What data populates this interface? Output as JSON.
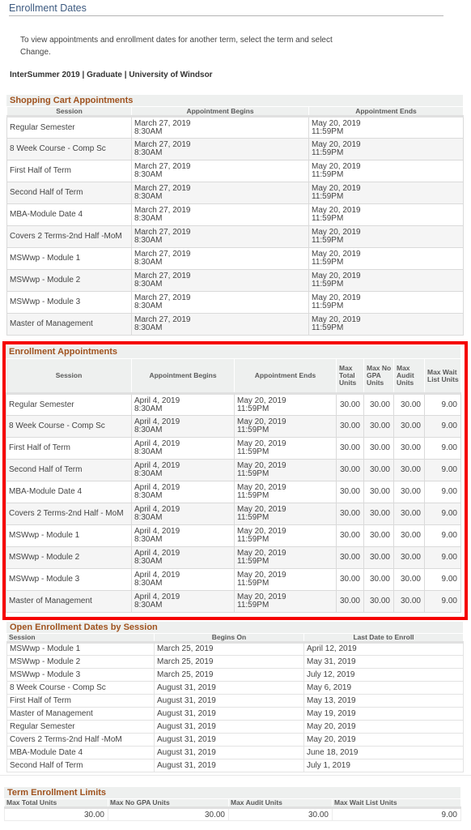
{
  "page": {
    "title": "Enrollment Dates",
    "instructions": "To view appointments and enrollment dates for another term, select the term and select Change.",
    "term_line": "InterSummer 2019 | Graduate | University of Windsor"
  },
  "shopping_cart": {
    "title": "Shopping Cart Appointments",
    "columns": [
      "Session",
      "Appointment Begins",
      "Appointment Ends"
    ],
    "rows": [
      {
        "session": "Regular Semester",
        "begin_date": "March 27, 2019",
        "begin_time": "8:30AM",
        "end_date": "May 20, 2019",
        "end_time": "11:59PM"
      },
      {
        "session": "8 Week Course - Comp Sc",
        "begin_date": "March 27, 2019",
        "begin_time": "8:30AM",
        "end_date": "May 20, 2019",
        "end_time": "11:59PM"
      },
      {
        "session": "First Half of Term",
        "begin_date": "March 27, 2019",
        "begin_time": "8:30AM",
        "end_date": "May 20, 2019",
        "end_time": "11:59PM"
      },
      {
        "session": "Second Half of Term",
        "begin_date": "March 27, 2019",
        "begin_time": "8:30AM",
        "end_date": "May 20, 2019",
        "end_time": "11:59PM"
      },
      {
        "session": "MBA-Module Date 4",
        "begin_date": "March 27, 2019",
        "begin_time": "8:30AM",
        "end_date": "May 20, 2019",
        "end_time": "11:59PM"
      },
      {
        "session": "Covers 2 Terms-2nd Half -MoM",
        "begin_date": "March 27, 2019",
        "begin_time": "8:30AM",
        "end_date": "May 20, 2019",
        "end_time": "11:59PM"
      },
      {
        "session": "MSWwp - Module 1",
        "begin_date": "March 27, 2019",
        "begin_time": "8:30AM",
        "end_date": "May 20, 2019",
        "end_time": "11:59PM"
      },
      {
        "session": "MSWwp - Module 2",
        "begin_date": "March 27, 2019",
        "begin_time": "8:30AM",
        "end_date": "May 20, 2019",
        "end_time": "11:59PM"
      },
      {
        "session": "MSWwp - Module 3",
        "begin_date": "March 27, 2019",
        "begin_time": "8:30AM",
        "end_date": "May 20, 2019",
        "end_time": "11:59PM"
      },
      {
        "session": "Master of Management",
        "begin_date": "March 27, 2019",
        "begin_time": "8:30AM",
        "end_date": "May 20, 2019",
        "end_time": "11:59PM"
      }
    ]
  },
  "enrollment_appointments": {
    "title": "Enrollment Appointments",
    "highlight_color": "#f50000",
    "columns": [
      "Session",
      "Appointment Begins",
      "Appointment Ends",
      "Max Total Units",
      "Max No GPA Units",
      "Max Audit Units",
      "Max Wait List Units"
    ],
    "rows": [
      {
        "session": "Regular Semester",
        "begin_date": "April 4, 2019",
        "begin_time": "8:30AM",
        "end_date": "May 20, 2019",
        "end_time": "11:59PM",
        "max_total": "30.00",
        "max_no_gpa": "30.00",
        "max_audit": "30.00",
        "max_wait_list": "9.00"
      },
      {
        "session": "8 Week Course - Comp Sc",
        "begin_date": "April 4, 2019",
        "begin_time": "8:30AM",
        "end_date": "May 20, 2019",
        "end_time": "11:59PM",
        "max_total": "30.00",
        "max_no_gpa": "30.00",
        "max_audit": "30.00",
        "max_wait_list": "9.00"
      },
      {
        "session": "First Half of Term",
        "begin_date": "April 4, 2019",
        "begin_time": "8:30AM",
        "end_date": "May 20, 2019",
        "end_time": "11:59PM",
        "max_total": "30.00",
        "max_no_gpa": "30.00",
        "max_audit": "30.00",
        "max_wait_list": "9.00"
      },
      {
        "session": "Second Half of Term",
        "begin_date": "April 4, 2019",
        "begin_time": "8:30AM",
        "end_date": "May 20, 2019",
        "end_time": "11:59PM",
        "max_total": "30.00",
        "max_no_gpa": "30.00",
        "max_audit": "30.00",
        "max_wait_list": "9.00"
      },
      {
        "session": "MBA-Module Date 4",
        "begin_date": "April 4, 2019",
        "begin_time": "8:30AM",
        "end_date": "May 20, 2019",
        "end_time": "11:59PM",
        "max_total": "30.00",
        "max_no_gpa": "30.00",
        "max_audit": "30.00",
        "max_wait_list": "9.00"
      },
      {
        "session": "Covers 2 Terms-2nd Half - MoM",
        "begin_date": "April 4, 2019",
        "begin_time": "8:30AM",
        "end_date": "May 20, 2019",
        "end_time": "11:59PM",
        "max_total": "30.00",
        "max_no_gpa": "30.00",
        "max_audit": "30.00",
        "max_wait_list": "9.00"
      },
      {
        "session": "MSWwp - Module 1",
        "begin_date": "April 4, 2019",
        "begin_time": "8:30AM",
        "end_date": "May 20, 2019",
        "end_time": "11:59PM",
        "max_total": "30.00",
        "max_no_gpa": "30.00",
        "max_audit": "30.00",
        "max_wait_list": "9.00"
      },
      {
        "session": "MSWwp - Module 2",
        "begin_date": "April 4, 2019",
        "begin_time": "8:30AM",
        "end_date": "May 20, 2019",
        "end_time": "11:59PM",
        "max_total": "30.00",
        "max_no_gpa": "30.00",
        "max_audit": "30.00",
        "max_wait_list": "9.00"
      },
      {
        "session": "MSWwp - Module 3",
        "begin_date": "April 4, 2019",
        "begin_time": "8:30AM",
        "end_date": "May 20, 2019",
        "end_time": "11:59PM",
        "max_total": "30.00",
        "max_no_gpa": "30.00",
        "max_audit": "30.00",
        "max_wait_list": "9.00"
      },
      {
        "session": "Master of Management",
        "begin_date": "April 4, 2019",
        "begin_time": "8:30AM",
        "end_date": "May 20, 2019",
        "end_time": "11:59PM",
        "max_total": "30.00",
        "max_no_gpa": "30.00",
        "max_audit": "30.00",
        "max_wait_list": "9.00"
      }
    ]
  },
  "open_enrollment": {
    "title": "Open Enrollment Dates by Session",
    "columns": [
      "Session",
      "Begins On",
      "Last Date to Enroll"
    ],
    "rows": [
      {
        "session": "MSWwp - Module 1",
        "begins_on": "March 25, 2019",
        "last_date": "April 12, 2019"
      },
      {
        "session": "MSWwp - Module 2",
        "begins_on": "March 25, 2019",
        "last_date": "May 31, 2019"
      },
      {
        "session": "MSWwp - Module 3",
        "begins_on": "March 25, 2019",
        "last_date": "July 12, 2019"
      },
      {
        "session": "8 Week Course - Comp Sc",
        "begins_on": "August 31, 2019",
        "last_date": "May 6, 2019"
      },
      {
        "session": "First Half of Term",
        "begins_on": "August 31, 2019",
        "last_date": "May 13, 2019"
      },
      {
        "session": "Master of Management",
        "begins_on": "August 31, 2019",
        "last_date": "May 19, 2019"
      },
      {
        "session": "Regular Semester",
        "begins_on": "August 31, 2019",
        "last_date": "May 20, 2019"
      },
      {
        "session": "Covers 2 Terms-2nd Half -MoM",
        "begins_on": "August 31, 2019",
        "last_date": "May 20, 2019"
      },
      {
        "session": "MBA-Module Date 4",
        "begins_on": "August 31, 2019",
        "last_date": "June 18, 2019"
      },
      {
        "session": "Second Half of Term",
        "begins_on": "August 31, 2019",
        "last_date": "July 1, 2019"
      }
    ]
  },
  "term_limits": {
    "title": "Term Enrollment Limits",
    "columns": [
      "Max Total Units",
      "Max No GPA Units",
      "Max Audit Units",
      "Max Wait List Units"
    ],
    "values": [
      "30.00",
      "30.00",
      "30.00",
      "9.00"
    ]
  }
}
